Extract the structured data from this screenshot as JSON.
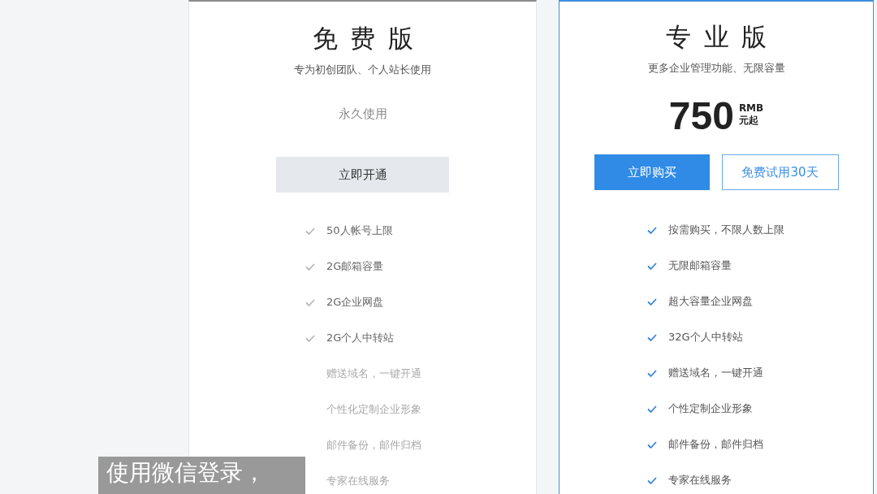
{
  "plans": [
    {
      "kind": "free",
      "highlighted": false,
      "title": "免费版",
      "tagline": "专为初创团队、个人站长使用",
      "price_note": "永久使用",
      "actions": [
        {
          "kind": "secondary",
          "label": "立即开通"
        }
      ],
      "features": [
        {
          "label": "50人帐号上限",
          "included": true
        },
        {
          "label": "2G邮箱容量",
          "included": true
        },
        {
          "label": "2G企业网盘",
          "included": true
        },
        {
          "label": "2G个人中转站",
          "included": true
        },
        {
          "label": "赠送域名，一键开通",
          "included": false
        },
        {
          "label": "个性化定制企业形象",
          "included": false
        },
        {
          "label": "邮件备份，邮件归档",
          "included": false
        },
        {
          "label": "专家在线服务",
          "included": false
        }
      ]
    },
    {
      "kind": "pro",
      "highlighted": true,
      "title": "专业版",
      "tagline": "更多企业管理功能、无限容量",
      "price": {
        "amount": "750",
        "currency": "RMB",
        "suffix": "元起"
      },
      "actions": [
        {
          "kind": "primary",
          "label": "立即购买"
        },
        {
          "kind": "outline",
          "label": "免费试用30天"
        }
      ],
      "features": [
        {
          "label": "按需购买，不限人数上限",
          "included": true
        },
        {
          "label": "无限邮箱容量",
          "included": true
        },
        {
          "label": "超大容量企业网盘",
          "included": true
        },
        {
          "label": "32G个人中转站",
          "included": true
        },
        {
          "label": "赠送域名，一键开通",
          "included": true
        },
        {
          "label": "个性定制企业形象",
          "included": true
        },
        {
          "label": "邮件备份，邮件归档",
          "included": true
        },
        {
          "label": "专家在线服务",
          "included": true
        }
      ]
    }
  ],
  "subtitle": "使用微信登录，"
}
